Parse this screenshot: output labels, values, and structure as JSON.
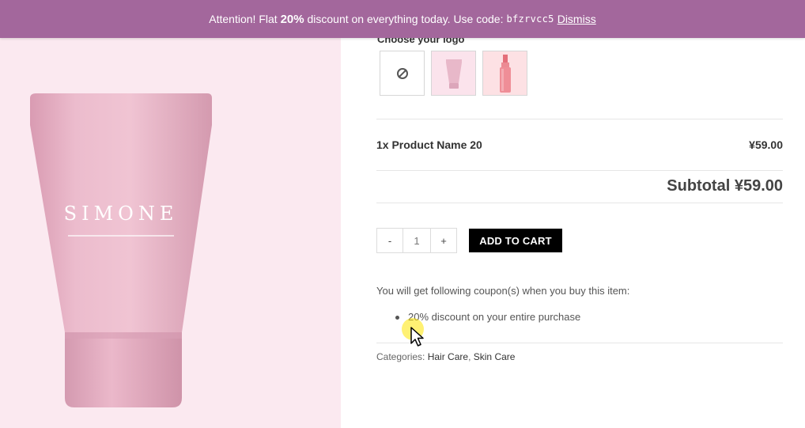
{
  "notice": {
    "text_before": "Attention! Flat",
    "discount": "20%",
    "text_after": "discount on everything today. Use code:",
    "code": "bfzrvcc5",
    "dismiss": "Dismiss"
  },
  "product_image": {
    "brand": "SIMONE"
  },
  "logo_selector": {
    "label": "Choose your logo",
    "options": [
      "none-icon",
      "tube-thumbnail",
      "bottle-thumbnail"
    ]
  },
  "line_item": {
    "name": "1x Product Name 20",
    "price": "¥59.00"
  },
  "subtotal": "Subtotal ¥59.00",
  "quantity": {
    "minus": "-",
    "value": "1",
    "plus": "+"
  },
  "add_to_cart": "ADD TO CART",
  "coupons": {
    "intro": "You will get following coupon(s) when you buy this item:",
    "items": [
      "20% discount on your entire purchase"
    ]
  },
  "categories": {
    "label": "Categories:",
    "items": [
      "Hair Care",
      "Skin Care"
    ],
    "separator": ","
  },
  "colors": {
    "notice_bg": "#a3679c",
    "image_bg": "#fbe9f0",
    "tube": "#eab5c8",
    "button_bg": "#000000"
  }
}
